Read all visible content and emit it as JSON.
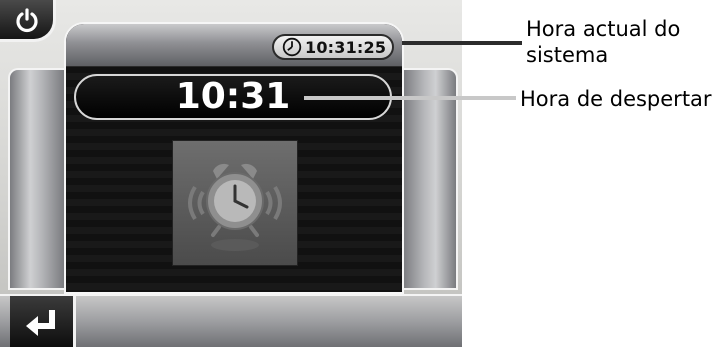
{
  "system_time": "10:31:25",
  "alarm_time": "10:31",
  "callouts": {
    "current_system_time": "Hora actual do sistema",
    "wake_time": "Hora de despertar"
  },
  "icons": {
    "power": "power-icon",
    "clock": "clock-icon",
    "alarm": "alarm-clock-icon",
    "back": "return-arrow-icon"
  },
  "colors": {
    "screen_dark": "#111111",
    "frame_white": "#f6f6f6",
    "wake_text": "#ffffff"
  }
}
